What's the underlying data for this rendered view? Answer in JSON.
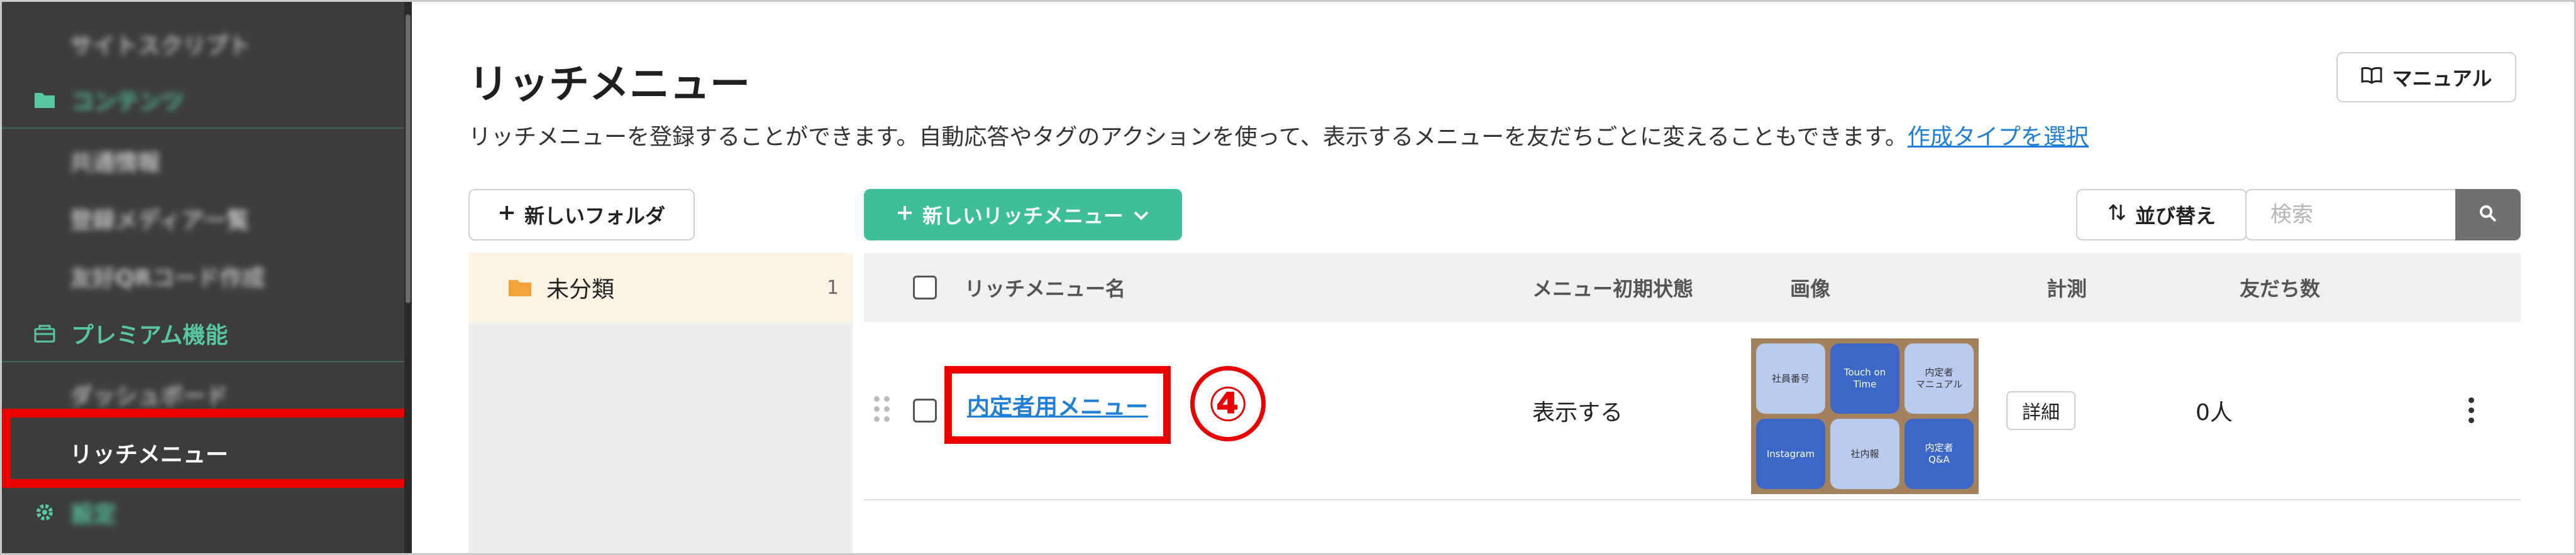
{
  "sidebar": {
    "items": [
      {
        "label": "サイトスクリプト",
        "type": "sub",
        "blurred": true
      },
      {
        "label": "コンテンツ",
        "type": "section",
        "blurred": true,
        "icon": "folder-icon"
      },
      {
        "label": "共通情報",
        "type": "sub",
        "blurred": true
      },
      {
        "label": "登録メディア一覧",
        "type": "sub",
        "blurred": true
      },
      {
        "label": "友好QRコード作成",
        "type": "sub",
        "blurred": true
      },
      {
        "label": "プレミアム機能",
        "type": "section",
        "blurred": false,
        "icon": "premium-icon"
      },
      {
        "label": "ダッシュボード",
        "type": "sub",
        "blurred": true
      },
      {
        "label": "リッチメニュー",
        "type": "sub",
        "blurred": false,
        "active": true
      },
      {
        "label": "設定",
        "type": "section",
        "blurred": true,
        "icon": "gear-icon"
      }
    ]
  },
  "header": {
    "title": "リッチメニュー",
    "description": "リッチメニューを登録することができます。自動応答やタグのアクションを使って、表示するメニューを友だちごとに変えることもできます。",
    "description_link": "作成タイプを選択",
    "manual_label": "マニュアル"
  },
  "toolbar": {
    "new_folder_label": "新しいフォルダ",
    "new_menu_label": "新しいリッチメニュー",
    "sort_label": "並び替え",
    "search_placeholder": "検索"
  },
  "folders": [
    {
      "name": "未分類",
      "count": "1"
    }
  ],
  "table": {
    "columns": [
      "リッチメニュー名",
      "メニュー初期状態",
      "画像",
      "計測",
      "友だち数"
    ],
    "rows": [
      {
        "name": "内定者用メニュー",
        "status": "表示する",
        "detail_label": "詳細",
        "friends": "0人",
        "thumbnail_tiles": [
          {
            "text": "社員番号",
            "style": "light"
          },
          {
            "text": "Touch on Time",
            "style": "dark"
          },
          {
            "text": "内定者\nマニュアル",
            "style": "light"
          },
          {
            "text": "Instagram",
            "style": "dark"
          },
          {
            "text": "社内報",
            "style": "light"
          },
          {
            "text": "内定者\nQ&A",
            "style": "dark"
          }
        ]
      }
    ]
  },
  "annotation": {
    "step_number": "④"
  },
  "colors": {
    "accent_green": "#3ebf9a",
    "link_blue": "#1f7fd6",
    "highlight_red": "#ea0000",
    "sidebar_bg": "#3c3c3c"
  }
}
